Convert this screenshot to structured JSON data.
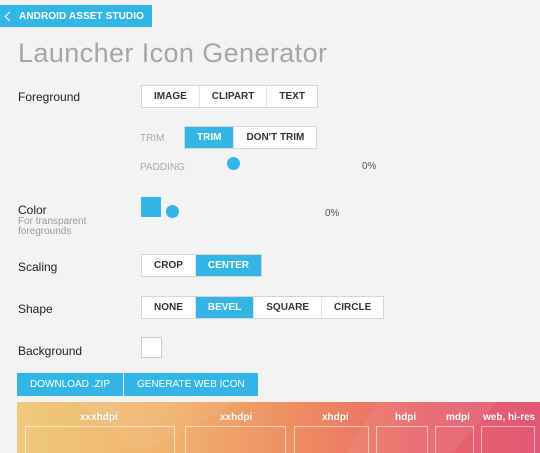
{
  "header": {
    "back_label": "ANDROID ASSET STUDIO"
  },
  "page": {
    "title": "Launcher Icon Generator"
  },
  "foreground": {
    "label": "Foreground",
    "options": [
      "IMAGE",
      "CLIPART",
      "TEXT"
    ],
    "trim_label": "TRIM",
    "trim_options": [
      "TRIM",
      "DON'T TRIM"
    ],
    "trim_selected": "TRIM",
    "padding_label": "PADDING",
    "padding_value": "0%"
  },
  "color": {
    "label": "Color",
    "sublabel_line1": "For transparent",
    "sublabel_line2": "foregrounds",
    "swatch": "#33b5e5",
    "value": "0%"
  },
  "scaling": {
    "label": "Scaling",
    "options": [
      "CROP",
      "CENTER"
    ],
    "selected": "CENTER"
  },
  "shape": {
    "label": "Shape",
    "options": [
      "NONE",
      "BEVEL",
      "SQUARE",
      "CIRCLE"
    ],
    "selected": "BEVEL"
  },
  "background": {
    "label": "Background",
    "color": "#ffffff"
  },
  "actions": {
    "download": "DOWNLOAD .ZIP",
    "web_icon": "GENERATE WEB ICON"
  },
  "preview": {
    "densities": [
      "xxxhdpi",
      "xxhdpi",
      "xhdpi",
      "hdpi",
      "mdpi",
      "web, hi-res"
    ]
  },
  "colors": {
    "accent": "#33b5e5",
    "text": "#333333",
    "muted": "#a6a6a6"
  }
}
